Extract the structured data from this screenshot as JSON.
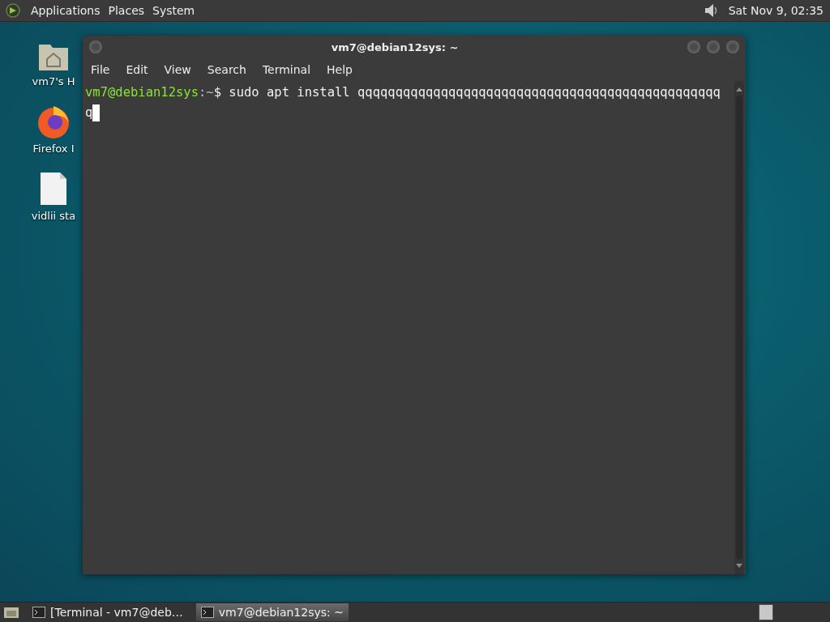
{
  "top_panel": {
    "menus": [
      "Applications",
      "Places",
      "System"
    ],
    "clock": "Sat Nov 9, 02:35"
  },
  "desktop_icons": [
    {
      "kind": "home",
      "label": "vm7's H"
    },
    {
      "kind": "browser",
      "label": "Firefox I"
    },
    {
      "kind": "file",
      "label": "vidlii sta"
    }
  ],
  "window": {
    "title": "vm7@debian12sys: ~",
    "menu": [
      "File",
      "Edit",
      "View",
      "Search",
      "Terminal",
      "Help"
    ],
    "terminal": {
      "prompt": {
        "user_host": "vm7@debian12sys",
        "path": ":~",
        "symbol": "$"
      },
      "command": "sudo apt install qqqqqqqqqqqqqqqqqqqqqqqqqqqqqqqqqqqqqqqqqqqqqqqq",
      "wrapped": "q",
      "cursor": true
    }
  },
  "taskbar": {
    "tasks": [
      {
        "label": "[Terminal - vm7@deb…",
        "selected": false
      },
      {
        "label": "vm7@debian12sys: ~",
        "selected": true
      }
    ]
  }
}
